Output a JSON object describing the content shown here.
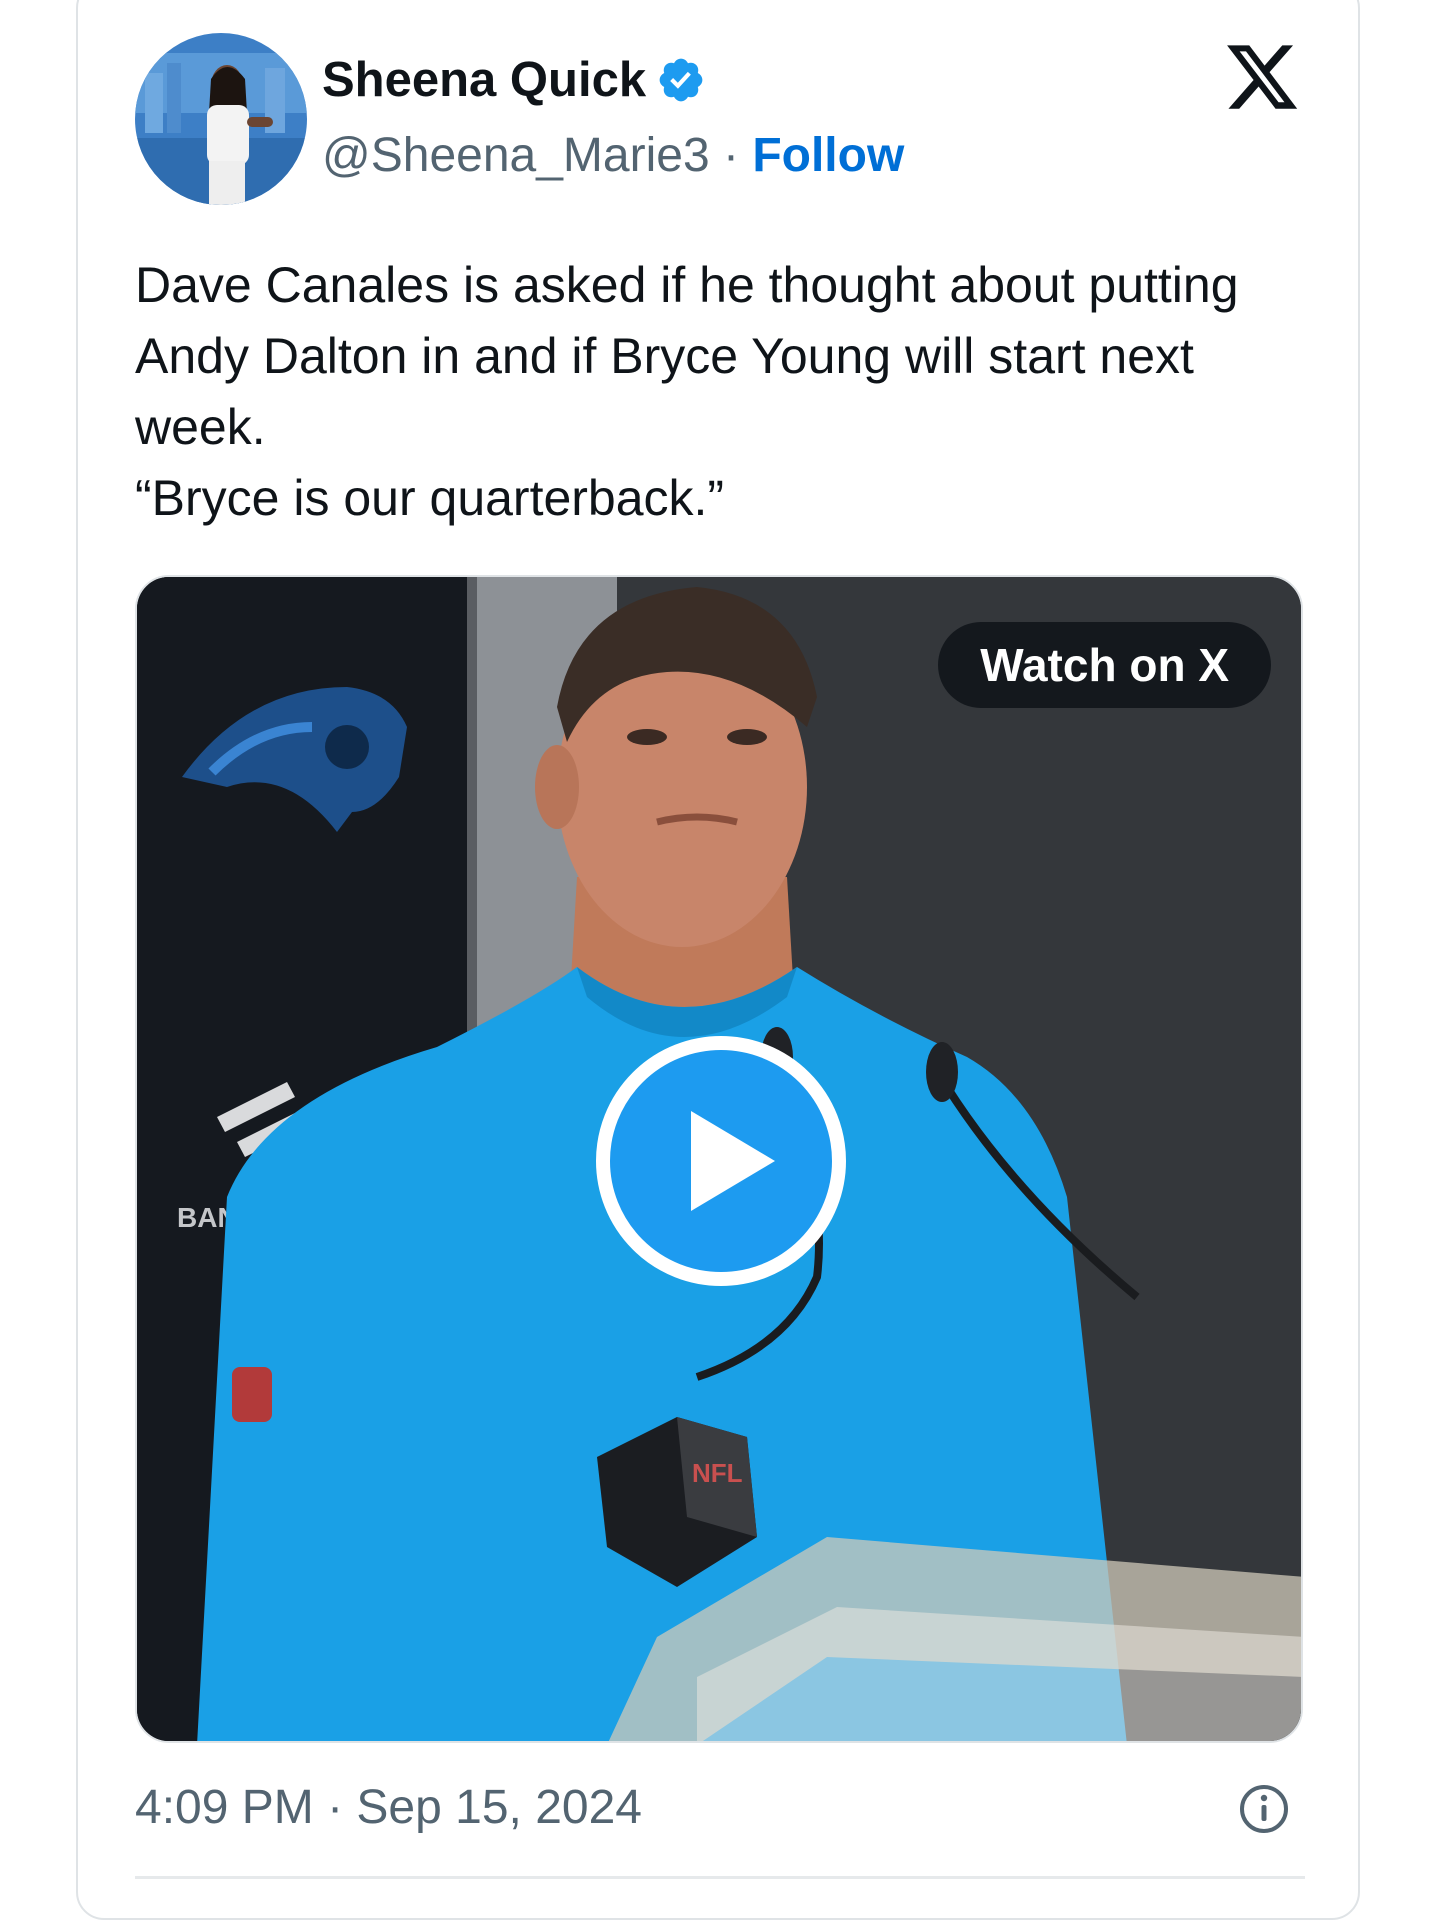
{
  "author": {
    "name": "Sheena Quick",
    "handle": "@Sheena_Marie3",
    "separator": "·",
    "follow_label": "Follow",
    "verified": true
  },
  "tweet": {
    "text_lines": [
      "Dave Canales is asked if he thought about putting Andy Dalton in and if Bryce Young will start next week.",
      "“Bryce is our quarterback.”"
    ]
  },
  "media": {
    "watch_label": "Watch on X",
    "backdrop_text": "BANK C",
    "podium_text": "NFL"
  },
  "footer": {
    "timestamp": "4:09 PM · Sep 15, 2024"
  },
  "icons": {
    "verified": "verified-badge-icon",
    "brand": "x-logo-icon",
    "play": "play-icon",
    "info": "info-icon"
  },
  "colors": {
    "accent": "#1d9bf0",
    "follow": "#006fd6",
    "text": "#0f1419",
    "muted": "#536471",
    "shirt": "#1aa0e6"
  }
}
